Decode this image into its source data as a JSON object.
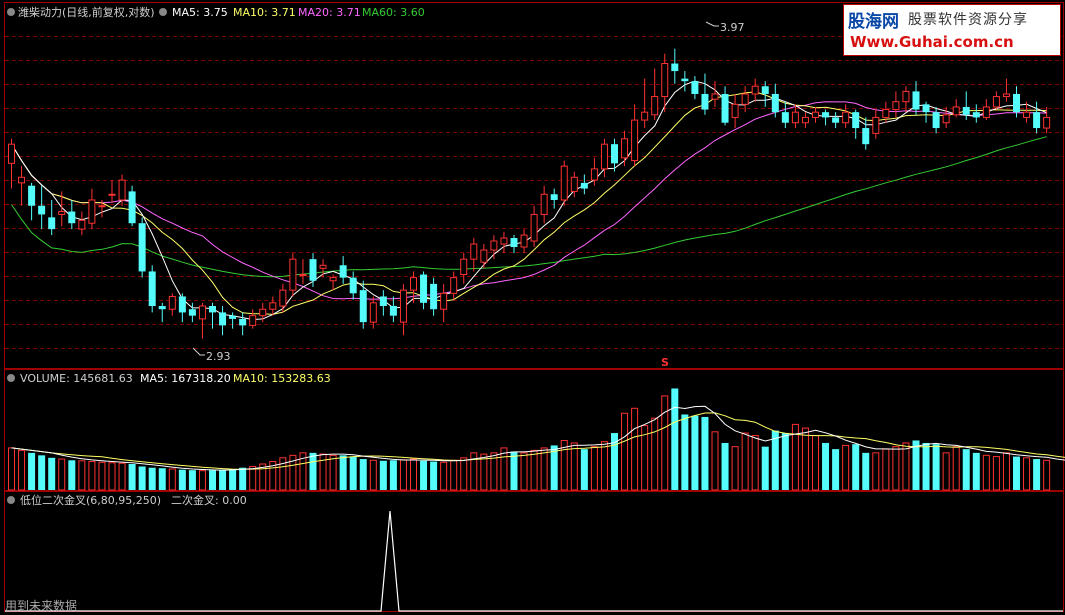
{
  "colors": {
    "up": "#ff3232",
    "down": "#54fcfc",
    "ma5": "#ffffff",
    "ma10": "#ffff66",
    "ma20": "#ff66ff",
    "ma60": "#33cc33",
    "grid": "#800000",
    "border": "#a00000",
    "text": "#cfcfcf"
  },
  "main_legend": {
    "name": "潍柴动力(日线,前复权,对数)",
    "ma5": "MA5: 3.75",
    "ma10": "MA10: 3.71",
    "ma20": "MA20: 3.71",
    "ma60": "MA60: 3.60"
  },
  "volume_legend": {
    "name": "VOLUME: 145681.63",
    "ma5": "MA5: 167318.20",
    "ma10": "MA10: 153283.63"
  },
  "indicator_legend": {
    "name": "低位二次金叉(6,80,95,250)",
    "value": "二次金叉: 0.00"
  },
  "annotations": {
    "high": "3.97",
    "low": "2.93",
    "marker": "S",
    "future_note": "用到未来数据"
  },
  "watermark": {
    "brand": "股海网",
    "slogan": "股票软件资源分享",
    "url": "Www.Guhai.com.cn"
  },
  "chart_data": [
    {
      "type": "candlestick",
      "note": "price panel, log scale, values estimated",
      "ylim": [
        2.88,
        4.08
      ],
      "open": [
        3.53,
        3.46,
        3.45,
        3.38,
        3.34,
        3.35,
        3.36,
        3.3,
        3.32,
        3.38,
        3.42,
        3.4,
        3.43,
        3.32,
        3.16,
        3.05,
        3.04,
        3.08,
        3.04,
        3.01,
        3.05,
        3.03,
        3.02,
        3.01,
        2.99,
        3.02,
        3.04,
        3.05,
        3.1,
        3.15,
        3.2,
        3.17,
        3.13,
        3.18,
        3.14,
        3.1,
        3.0,
        3.08,
        3.05,
        3.0,
        3.1,
        3.15,
        3.12,
        3.04,
        3.09,
        3.15,
        3.2,
        3.19,
        3.23,
        3.25,
        3.27,
        3.24,
        3.26,
        3.35,
        3.42,
        3.4,
        3.43,
        3.46,
        3.47,
        3.51,
        3.6,
        3.55,
        3.54,
        3.69,
        3.71,
        3.78,
        3.91,
        3.85,
        3.84,
        3.79,
        3.77,
        3.79,
        3.7,
        3.75,
        3.79,
        3.82,
        3.79,
        3.72,
        3.68,
        3.68,
        3.7,
        3.72,
        3.7,
        3.68,
        3.72,
        3.66,
        3.64,
        3.7,
        3.73,
        3.76,
        3.8,
        3.75,
        3.72,
        3.68,
        3.71,
        3.74,
        3.72,
        3.7,
        3.74,
        3.78,
        3.79,
        3.7,
        3.72,
        3.66
      ],
      "close": [
        3.6,
        3.48,
        3.38,
        3.35,
        3.3,
        3.36,
        3.32,
        3.33,
        3.4,
        3.38,
        3.42,
        3.47,
        3.32,
        3.16,
        3.05,
        3.04,
        3.08,
        3.03,
        3.02,
        3.05,
        3.03,
        2.99,
        3.01,
        2.99,
        3.02,
        3.04,
        3.06,
        3.1,
        3.2,
        3.15,
        3.13,
        3.18,
        3.14,
        3.14,
        3.09,
        3.0,
        3.06,
        3.05,
        3.02,
        3.1,
        3.14,
        3.06,
        3.04,
        3.09,
        3.14,
        3.2,
        3.25,
        3.23,
        3.26,
        3.27,
        3.24,
        3.28,
        3.35,
        3.42,
        3.4,
        3.52,
        3.48,
        3.44,
        3.51,
        3.6,
        3.53,
        3.62,
        3.69,
        3.72,
        3.78,
        3.91,
        3.88,
        3.84,
        3.79,
        3.73,
        3.79,
        3.68,
        3.75,
        3.79,
        3.82,
        3.79,
        3.72,
        3.68,
        3.72,
        3.7,
        3.72,
        3.7,
        3.68,
        3.72,
        3.66,
        3.6,
        3.7,
        3.73,
        3.76,
        3.8,
        3.73,
        3.72,
        3.66,
        3.71,
        3.74,
        3.71,
        3.7,
        3.74,
        3.78,
        3.79,
        3.72,
        3.72,
        3.66,
        3.7
      ],
      "high": [
        3.62,
        3.52,
        3.46,
        3.45,
        3.4,
        3.43,
        3.4,
        3.36,
        3.44,
        3.4,
        3.47,
        3.49,
        3.45,
        3.34,
        3.18,
        3.06,
        3.09,
        3.09,
        3.06,
        3.06,
        3.06,
        3.05,
        3.03,
        3.03,
        3.04,
        3.06,
        3.08,
        3.12,
        3.22,
        3.2,
        3.22,
        3.2,
        3.15,
        3.21,
        3.16,
        3.13,
        3.08,
        3.1,
        3.08,
        3.12,
        3.16,
        3.16,
        3.14,
        3.12,
        3.16,
        3.22,
        3.27,
        3.25,
        3.28,
        3.29,
        3.28,
        3.3,
        3.38,
        3.45,
        3.44,
        3.54,
        3.5,
        3.49,
        3.55,
        3.62,
        3.62,
        3.65,
        3.75,
        3.85,
        3.89,
        3.95,
        3.97,
        3.88,
        3.86,
        3.87,
        3.84,
        3.82,
        3.79,
        3.82,
        3.85,
        3.84,
        3.83,
        3.76,
        3.75,
        3.72,
        3.74,
        3.73,
        3.72,
        3.75,
        3.73,
        3.7,
        3.73,
        3.76,
        3.8,
        3.82,
        3.84,
        3.76,
        3.74,
        3.74,
        3.77,
        3.8,
        3.75,
        3.77,
        3.8,
        3.85,
        3.82,
        3.76,
        3.76,
        3.74
      ],
      "low": [
        3.44,
        3.38,
        3.33,
        3.3,
        3.28,
        3.31,
        3.3,
        3.28,
        3.3,
        3.34,
        3.39,
        3.38,
        3.31,
        3.14,
        3.03,
        3.0,
        3.02,
        3.0,
        3.0,
        2.95,
        2.98,
        2.96,
        2.98,
        2.96,
        2.98,
        3.0,
        3.02,
        3.03,
        3.08,
        3.12,
        3.11,
        3.14,
        3.1,
        3.12,
        3.07,
        2.98,
        2.98,
        3.02,
        3.0,
        2.96,
        3.06,
        3.04,
        3.02,
        3.0,
        3.07,
        3.12,
        3.16,
        3.17,
        3.2,
        3.22,
        3.22,
        3.22,
        3.24,
        3.32,
        3.37,
        3.38,
        3.41,
        3.42,
        3.45,
        3.48,
        3.5,
        3.52,
        3.52,
        3.66,
        3.69,
        3.72,
        3.83,
        3.8,
        3.77,
        3.71,
        3.74,
        3.67,
        3.66,
        3.72,
        3.76,
        3.74,
        3.7,
        3.66,
        3.66,
        3.66,
        3.68,
        3.67,
        3.66,
        3.66,
        3.62,
        3.58,
        3.62,
        3.68,
        3.7,
        3.72,
        3.71,
        3.68,
        3.64,
        3.66,
        3.7,
        3.69,
        3.68,
        3.69,
        3.73,
        3.76,
        3.7,
        3.68,
        3.64,
        3.64
      ]
    },
    {
      "type": "bar",
      "note": "volume panel, values estimated in thousands",
      "ylim": [
        0,
        420
      ],
      "values": [
        170,
        160,
        150,
        140,
        130,
        125,
        120,
        118,
        115,
        112,
        110,
        108,
        105,
        95,
        90,
        88,
        85,
        82,
        80,
        78,
        80,
        82,
        85,
        90,
        95,
        105,
        115,
        130,
        140,
        150,
        150,
        145,
        140,
        140,
        135,
        125,
        120,
        118,
        120,
        122,
        125,
        118,
        115,
        112,
        120,
        130,
        150,
        145,
        150,
        170,
        155,
        150,
        160,
        170,
        180,
        200,
        190,
        165,
        175,
        195,
        230,
        310,
        330,
        260,
        290,
        380,
        410,
        305,
        300,
        295,
        235,
        190,
        175,
        230,
        220,
        175,
        240,
        230,
        265,
        250,
        220,
        190,
        165,
        180,
        185,
        150,
        150,
        165,
        175,
        190,
        200,
        190,
        185,
        150,
        175,
        165,
        150,
        140,
        135,
        150,
        135,
        130,
        125,
        120,
        115,
        110,
        100
      ]
    }
  ]
}
